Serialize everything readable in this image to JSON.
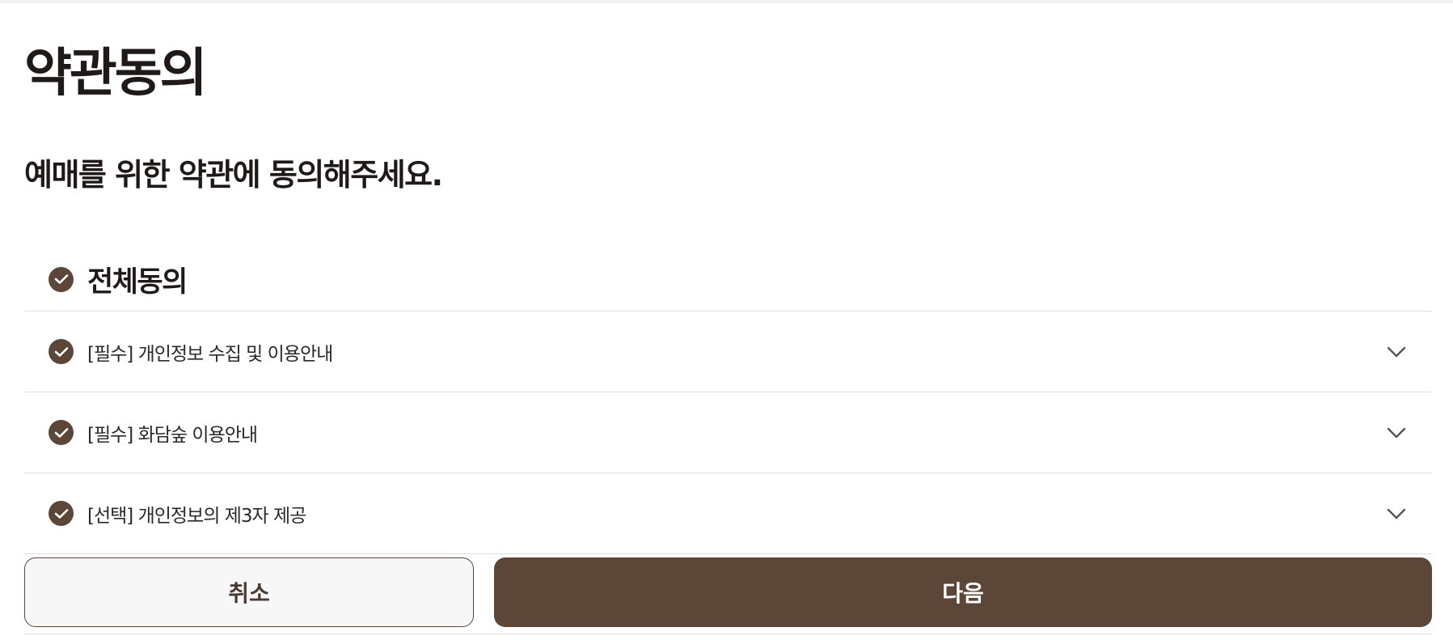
{
  "page": {
    "title": "약관동의",
    "subtitle": "예매를 위한 약관에 동의해주세요."
  },
  "agree_all": {
    "label": "전체동의",
    "checked": true,
    "icon": "check-circle-icon"
  },
  "terms": [
    {
      "label": "[필수] 개인정보 수집 및 이용안내",
      "checked": true,
      "expand_icon": "chevron-down-icon"
    },
    {
      "label": "[필수] 화담숲 이용안내",
      "checked": true,
      "expand_icon": "chevron-down-icon"
    },
    {
      "label": "[선택] 개인정보의 제3자 제공",
      "checked": true,
      "expand_icon": "chevron-down-icon"
    }
  ],
  "buttons": {
    "cancel": "취소",
    "next": "다음"
  },
  "colors": {
    "accent": "#5b4638",
    "divider": "#dedede",
    "cancel_bg": "#f7f7f7"
  }
}
